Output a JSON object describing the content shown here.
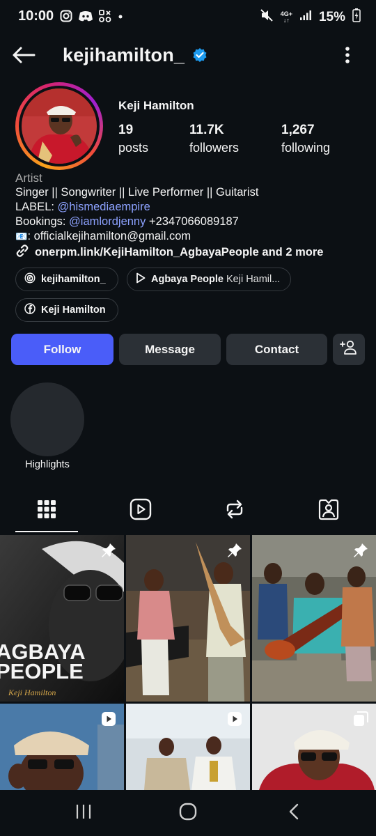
{
  "status_bar": {
    "time": "10:00",
    "network": "4G+",
    "battery": "15%",
    "icons": [
      "instagram-icon",
      "discord-icon",
      "apps-icon",
      "dot-icon",
      "mute-icon",
      "signal-icon",
      "battery-icon"
    ]
  },
  "header": {
    "username": "kejihamilton_",
    "verified": true
  },
  "profile": {
    "display_name": "Keji Hamilton",
    "stats": [
      {
        "value": "19",
        "label": "posts"
      },
      {
        "value": "11.7K",
        "label": "followers"
      },
      {
        "value": "1,267",
        "label": "following"
      }
    ],
    "category": "Artist",
    "bio": {
      "line1": "Singer || Songwriter || Live Performer || Guitarist",
      "label_prefix": "LABEL: ",
      "label_handle": "@hismediaempire",
      "bookings_prefix": "Bookings: ",
      "bookings_handle": "@iamlordjenny",
      "bookings_phone": " +2347066089187",
      "email_emoji": "📧",
      "email": ": officialkejihamilton@gmail.com"
    },
    "external_link": "onerpm.link/KejiHamilton_AgbayaPeople and 2 more"
  },
  "chips": {
    "threads": "kejihamilton_",
    "music_title": "Agbaya People",
    "music_artist": " Keji Hamil...",
    "facebook": "Keji Hamilton"
  },
  "actions": {
    "follow": "Follow",
    "message": "Message",
    "contact": "Contact"
  },
  "highlights": {
    "label": "Highlights"
  },
  "grid": {
    "tile1_text": "AGBAYA PEOPLE",
    "tile1_sub": "Keji Hamilton"
  },
  "colors": {
    "background": "#0c1014",
    "follow": "#4a5df9",
    "button": "#2b3036",
    "link": "#8da2ff",
    "verified": "#1d9bf0"
  }
}
